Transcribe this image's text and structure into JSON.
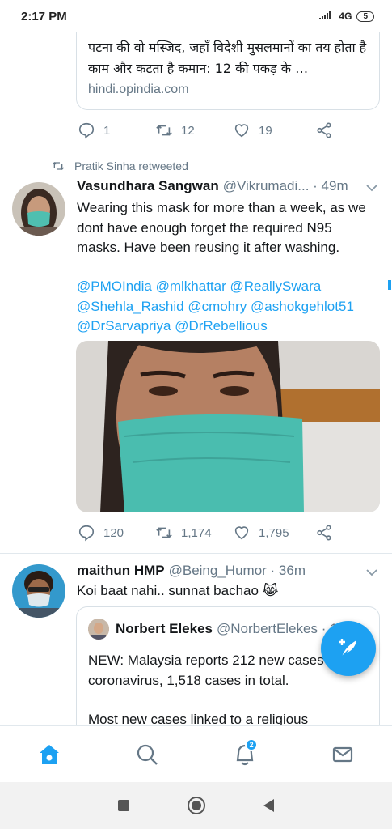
{
  "status_bar": {
    "time": "2:17 PM",
    "signal_icon": "signal-bars-icon",
    "network": "4G",
    "battery": "5"
  },
  "tweet_prev": {
    "card_text": "पटना की वो मस्जिद, जहाँ विदेशी मुसलमानों का तय होता है काम और कटता है कमान: 12 की पकड़ के …",
    "card_domain": "hindi.opindia.com",
    "replies": "1",
    "retweets": "12",
    "likes": "19"
  },
  "tweet_1": {
    "retweeted_by": "Pratik Sinha retweeted",
    "name": "Vasundhara Sangwan",
    "handle_time": "@Vikrumadi... · 49m",
    "text": "Wearing this mask for more than a week, as we dont have enough forget the required N95 masks. Have been reusing it after washing.",
    "mentions": [
      "@PMOIndia",
      "@mlkhattar",
      "@ReallySwara",
      "@Shehla_Rashid",
      "@cmohry",
      "@ashokgehlot51",
      "@DrSarvapriya",
      "@DrRebellious"
    ],
    "replies": "120",
    "retweets": "1,174",
    "likes": "1,795"
  },
  "tweet_2": {
    "name": "maithun HMP",
    "handle_time": "@Being_Humor · 36m",
    "text": "Koi baat nahi.. sunnat bachao 😹",
    "quote": {
      "name": "Norbert Elekes",
      "handle_time": "@NorbertElekes · 12h",
      "text_1": "NEW: Malaysia reports 212 new cases of coronavirus, 1,518 cases in total.",
      "text_2": "Most new cases linked to a religious"
    }
  },
  "tab_bar": {
    "home_icon": "home-icon",
    "search_icon": "search-icon",
    "notifications_icon": "bell-icon",
    "notifications_badge": "2",
    "messages_icon": "mail-icon"
  },
  "colors": {
    "accent": "#1da1f2",
    "secondary_text": "#657786"
  }
}
